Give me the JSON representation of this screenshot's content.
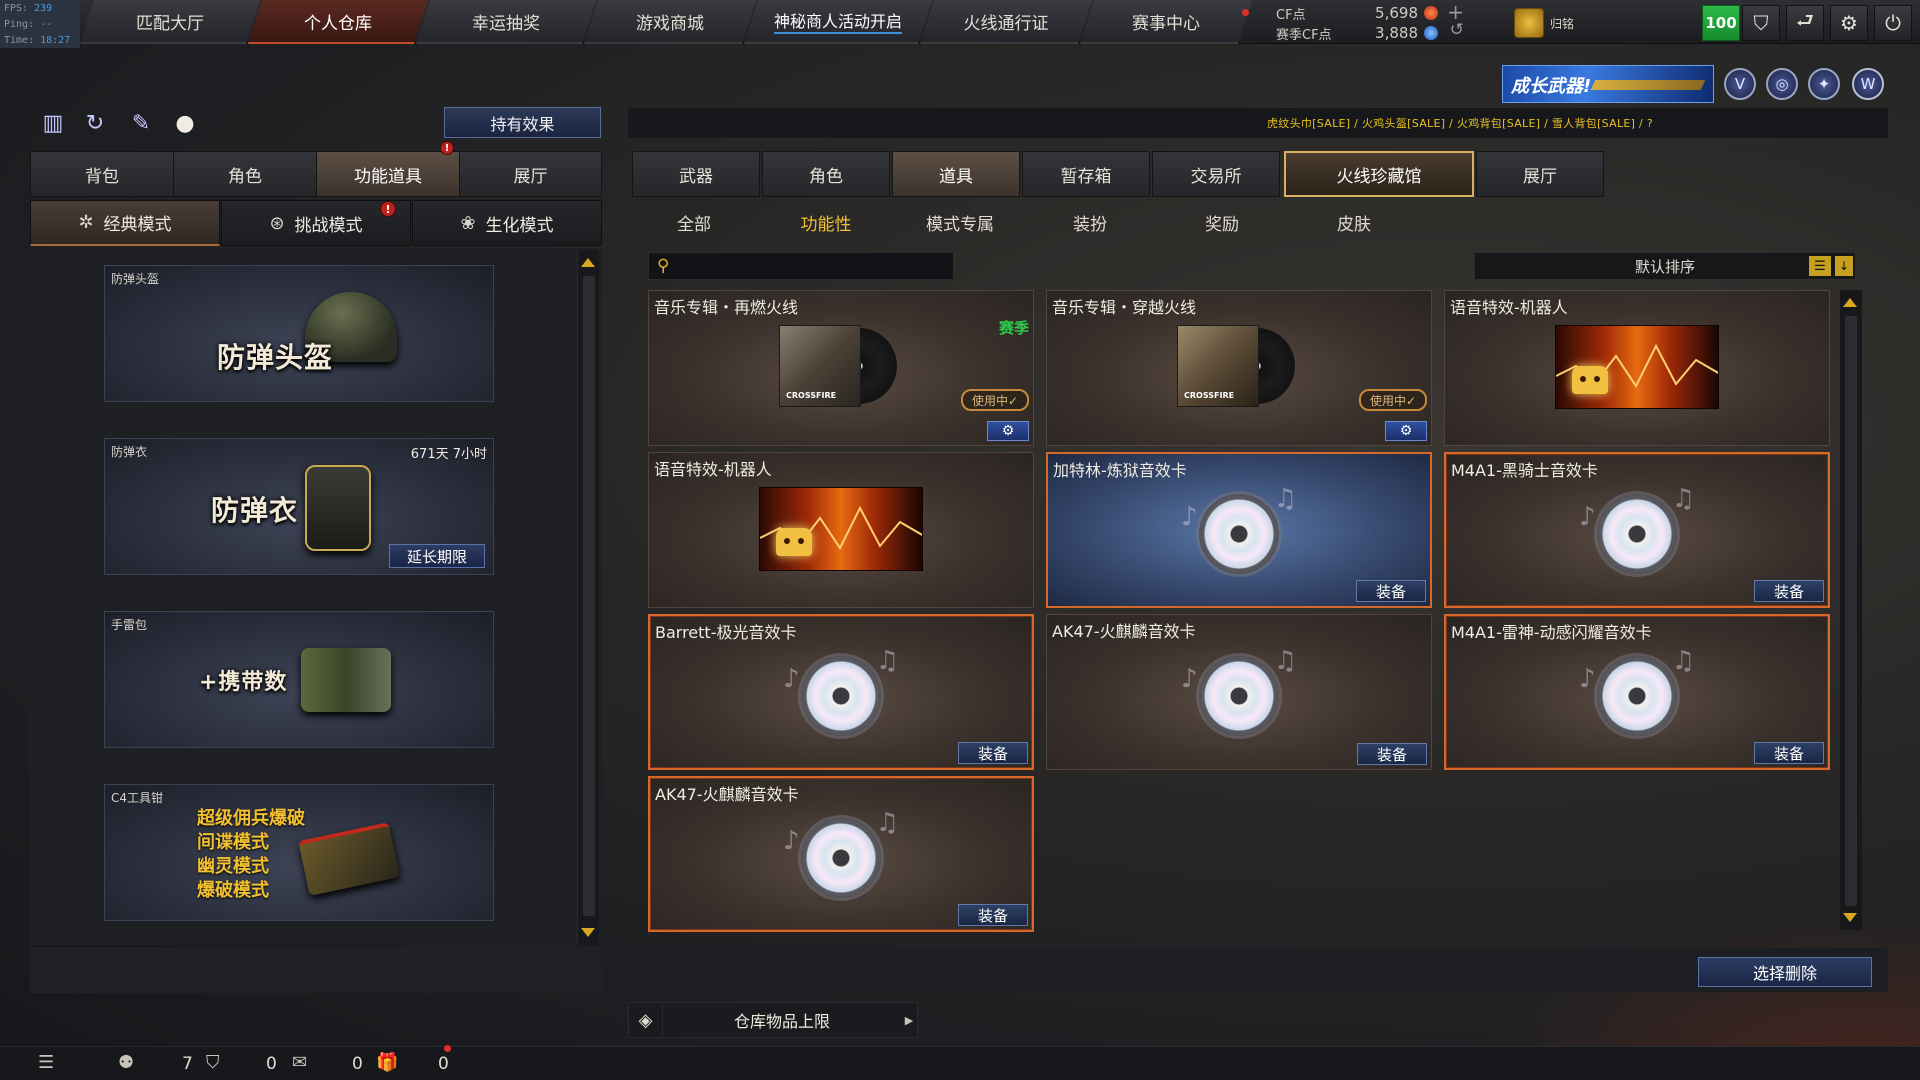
{
  "debug": {
    "fps_label": "FPS:",
    "fps": "239",
    "ping_label": "Ping:",
    "ping": "--",
    "time_label": "Time:",
    "time": "18:27"
  },
  "nav": {
    "tabs": [
      "匹配大厅",
      "个人仓库",
      "幸运抽奖",
      "游戏商城",
      "神秘商人活动开启",
      "火线通行证",
      "赛事中心"
    ],
    "active": "个人仓库"
  },
  "currency": {
    "cf_label": "CF点",
    "cf_value": "5,698",
    "season_label": "赛季CF点",
    "season_value": "3,888",
    "plus_icon": "plus-icon",
    "refresh_icon": "refresh-icon"
  },
  "user": {
    "name": "归铭",
    "level": "100"
  },
  "top_icons": [
    "shield-icon",
    "return-icon",
    "gear-icon",
    "power-icon"
  ],
  "promo": {
    "banner_text": "成长武器!",
    "badges": [
      "v-badge-icon",
      "globe-badge-icon",
      "star-badge-icon",
      "wing-badge-icon"
    ]
  },
  "sale_text": "虎纹头巾[SALE] / 火鸡头盔[SALE] / 火鸡背包[SALE] / 雪人背包[SALE] / ?",
  "left": {
    "quick_icons": [
      "ranking-icon",
      "history-icon",
      "spray-icon",
      "grenade-icon"
    ],
    "hold_effect": "持有效果",
    "tabs": [
      "背包",
      "角色",
      "功能道具",
      "展厅"
    ],
    "active_tab": "功能道具",
    "modes": [
      "经典模式",
      "挑战模式",
      "生化模式"
    ],
    "active_mode": "经典模式",
    "items": [
      {
        "name": "防弹头盔",
        "title": "防弹头盔",
        "time": "",
        "button": ""
      },
      {
        "name": "防弹衣",
        "title": "防弹衣",
        "time": "671天 7小时",
        "button": "延长期限"
      },
      {
        "name": "手雷包",
        "title": "+携带数",
        "time": "",
        "button": ""
      },
      {
        "name": "C4工具钳",
        "lines": [
          "超级佣兵爆破",
          "间谍模式",
          "幽灵模式",
          "爆破模式"
        ]
      }
    ]
  },
  "right": {
    "tabs": [
      "武器",
      "角色",
      "道具",
      "暂存箱",
      "交易所",
      "火线珍藏馆",
      "展厅"
    ],
    "active_tab": "道具",
    "subtabs": [
      "全部",
      "功能性",
      "模式专属",
      "装扮",
      "奖励",
      "皮肤"
    ],
    "active_subtab": "功能性",
    "search_placeholder": "",
    "sort_label": "默认排序",
    "items": [
      {
        "name": "音乐专辑・再燃火线",
        "kind": "album",
        "tag": "赛季",
        "status": "使用中✓",
        "cover_text": "CROSSFIRE"
      },
      {
        "name": "音乐专辑・穿越火线",
        "kind": "album",
        "tag": "",
        "status": "使用中✓",
        "cover_text": "CROSSFIRE"
      },
      {
        "name": "语音特效-机器人",
        "kind": "voice",
        "tag": "",
        "status": ""
      },
      {
        "name": "语音特效-机器人",
        "kind": "voice",
        "tag": "",
        "status": ""
      },
      {
        "name": "加特林-炼狱音效卡",
        "kind": "disc",
        "button": "装备"
      },
      {
        "name": "M4A1-黑骑士音效卡",
        "kind": "disc",
        "button": "装备"
      },
      {
        "name": "Barrett-极光音效卡",
        "kind": "disc",
        "button": "装备"
      },
      {
        "name": "AK47-火麒麟音效卡",
        "kind": "disc",
        "button": "装备"
      },
      {
        "name": "M4A1-雷神-动感闪耀音效卡",
        "kind": "disc",
        "button": "装备"
      },
      {
        "name": "AK47-火麒麟音效卡",
        "kind": "disc",
        "button": "装备"
      }
    ],
    "select_delete": "选择删除",
    "capacity_label": "仓库物品上限"
  },
  "status": {
    "friends": "7",
    "clan": "0",
    "chat": "0",
    "gift": "0"
  }
}
